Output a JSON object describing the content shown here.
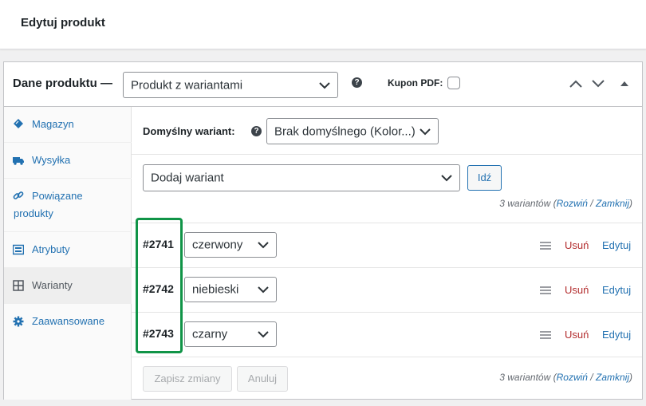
{
  "header": {
    "title": "Edytuj produkt"
  },
  "product_data": {
    "label": "Dane produktu —",
    "type_select": "Produkt z wariantami",
    "kupon_label": "Kupon PDF:"
  },
  "tabs": [
    {
      "label": "Magazyn",
      "icon": "diamond-tag-icon"
    },
    {
      "label": "Wysyłka",
      "icon": "truck-icon"
    },
    {
      "label": "Powiązane",
      "label2": "produkty",
      "icon": "link-icon"
    },
    {
      "label": "Atrybuty",
      "icon": "list-icon"
    },
    {
      "label": "Warianty",
      "icon": "grid-icon"
    },
    {
      "label": "Zaawansowane",
      "icon": "gear-icon"
    }
  ],
  "variations": {
    "default_label": "Domyślny wariant:",
    "default_select": "Brak domyślnego (Kolor...)",
    "add_select": "Dodaj wariant",
    "go_button": "Idź",
    "count_prefix": "3 wariantów (",
    "expand": "Rozwiń",
    "sep": " / ",
    "close": "Zamknij",
    "count_suffix": ")",
    "rows": [
      {
        "id": "#2741",
        "value": "czerwony",
        "remove": "Usuń",
        "edit": "Edytuj"
      },
      {
        "id": "#2742",
        "value": "niebieski",
        "remove": "Usuń",
        "edit": "Edytuj"
      },
      {
        "id": "#2743",
        "value": "czarny",
        "remove": "Usuń",
        "edit": "Edytuj"
      }
    ],
    "save_button": "Zapisz zmiany",
    "cancel_button": "Anuluj"
  },
  "colors": {
    "highlight": "#109447",
    "link": "#2271b1",
    "danger": "#b32d2e"
  }
}
